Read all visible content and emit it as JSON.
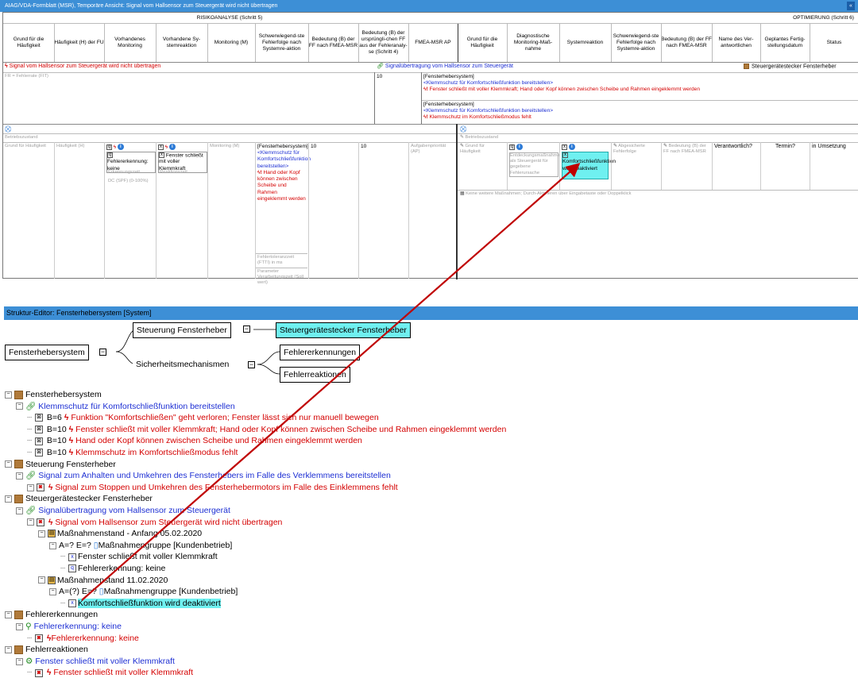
{
  "window": {
    "title": "AIAG/VDA-Formblatt (MSR), Temporäre Ansicht: Signal vom Hallsensor zum Steuergerät wird nicht übertragen",
    "close_glyph": "«"
  },
  "form": {
    "section_risk": "RISIKOANALYSE (Schritt 5)",
    "section_opt": "OPTIMIERUNG (Schritt 6)",
    "headers": [
      "Grund für die Häufigkeit",
      "Häufigkeit (H) der FU",
      "Vorhandenes Monitoring",
      "Vorhandene Sy-stemreaktion",
      "Monitoring (M)",
      "Schwerwiegend-ste Fehlerfolge nach Systemre-aktion",
      "Bedeutung (B) der FF nach FMEA-MSR",
      "Bedeutung (B) der ursprüngli-chen FF aus der Fehleranaly-se (Schritt 4)",
      "FMEA-MSR AP",
      "Grund für die Häufigkeit",
      "Diagnostische Monitoring-Maß-nahme",
      "Systemreaktion",
      "Schwerwiegend-ste Fehlerfolge nach Systemre-aktion",
      "Bedeutung (B) der FF nach FMEA-MSR",
      "Name des Ver-antwortlichen",
      "Geplantes Fertig-stellungsdatum",
      "Status"
    ],
    "row1_failure": "Signal vom Hallsensor zum Steuergerät wird nicht übertragen",
    "row1_function": "Signalübertragung vom Hallsensor zum Steuergerät",
    "row1_element": "Steuergerätestecker Fensterheber",
    "fr_label": "FR = Fehlerrate (FIT)",
    "b_value_top": "10",
    "effect1_sys": "[Fensterhebersystem]",
    "effect1_fn": "<Klemmschutz für Komfortschließfunktion bereitstellen>",
    "effect1_fail": "Fenster schließt mit voller Klemmkraft; Hand oder Kopf können zwischen Scheibe und Rahmen eingeklemmt werden",
    "effect2_sys": "[Fensterhebersystem]",
    "effect2_fn": "<Klemmschutz für Komfortschließfunktion bereitstellen>",
    "effect2_fail": "Klemmschutz im Komfortschließmodus fehlt",
    "betriebszustand": "Betriebszustand",
    "ph_grund": "Grund für Häufigkeit",
    "ph_haeuf": "Häufigkeit (H)",
    "mon_text": "Fehlererkennung: keine",
    "ph_erkzeit": "Erkennungszeit",
    "ph_dc": "DC (SPF) (0-100%)",
    "sysreact_text": "Fenster schließt mit voller Klemmkraft",
    "ph_reakzeit": "Reaktionszeit",
    "ph_mon": "Monitoring (M)",
    "sev_sys": "[Fensterhebersystem]",
    "sev_fn": "<Klemmschutz für Komfortschließfunktion bereitstellen>",
    "sev_fail": "Hand oder Kopf können zwischen Scheibe und Rahmen eingeklemmt werden",
    "ph_ftti": "Fehlertoleranzzeit (FTTI) in ms",
    "ph_param": "Parameter Verarbeitungszeit (Soll wert)",
    "b_after": "10",
    "b_orig": "10",
    "ph_ap": "Aufgabenpriorität (AP)",
    "opt_betrieb": "Betriebszustand",
    "opt_grund": "Grund für Häufigkeit",
    "opt_diag": "Entdeckungsmaßnahme als Steuergerät für gegebene Fehlerursache",
    "opt_react": "Komfortschließfunktion wird deaktiviert",
    "opt_fe": "Abgesicherte Fehlerfolge",
    "opt_b": "Bedeutung (B) der FF nach FMEA-MSR",
    "opt_resp": "Verantwortlich?",
    "opt_date": "Termin?",
    "opt_status": "in Umsetzung",
    "opt_hint": "Keine weitere Maßnahmen; Durch-Aktivieren über Eingabetaste oder Doppelklick"
  },
  "structure": {
    "title": "Struktur-Editor: Fensterhebersystem [System]",
    "root": "Fensterhebersystem",
    "child1": "Steuerung Fensterheber",
    "child1_sel": "Steuergerätestecker Fensterheber",
    "child2": "Sicherheitsmechanismen",
    "child2_a": "Fehlererkennungen",
    "child2_b": "Fehlerreaktionen"
  },
  "tree": [
    {
      "indent": 0,
      "kind": "brown",
      "text": "Fensterhebersystem",
      "color": "#000000"
    },
    {
      "indent": 1,
      "kind": "fn",
      "text": "Klemmschutz für Komfortschließfunktion bereitstellen",
      "color": "#1d2fd3"
    },
    {
      "indent": 2,
      "kind": "effect",
      "prefix": "B=6",
      "text": "Funktion \"Komfortschließen\" geht verloren; Fenster lässt sich nur manuell bewegen",
      "color": "#d40000"
    },
    {
      "indent": 2,
      "kind": "effect",
      "prefix": "B=10",
      "text": "Fenster schließt mit voller Klemmkraft; Hand oder Kopf können zwischen Scheibe und Rahmen eingeklemmt werden",
      "color": "#d40000"
    },
    {
      "indent": 2,
      "kind": "effect",
      "prefix": "B=10",
      "text": "Hand oder Kopf können zwischen Scheibe und Rahmen eingeklemmt werden",
      "color": "#d40000"
    },
    {
      "indent": 2,
      "kind": "effect",
      "prefix": "B=10",
      "text": "Klemmschutz im Komfortschließmodus fehlt",
      "color": "#d40000"
    },
    {
      "indent": 0,
      "kind": "brown",
      "text": "Steuerung Fensterheber",
      "color": "#000000"
    },
    {
      "indent": 1,
      "kind": "fn",
      "text": "Signal zum Anhalten und Umkehren des Fensterhebers im Falle des Verklemmens bereitstellen",
      "color": "#1d2fd3"
    },
    {
      "indent": 2,
      "kind": "fail",
      "text": "Signal zum Stoppen und Umkehren des Fensterhebermotors im Falle des Einklemmens fehlt",
      "color": "#d40000"
    },
    {
      "indent": 0,
      "kind": "brown",
      "text": "Steuergerätestecker Fensterheber",
      "color": "#000000"
    },
    {
      "indent": 1,
      "kind": "fn",
      "text": "Signalübertragung vom Hallsensor zum Steuergerät",
      "color": "#1d2fd3"
    },
    {
      "indent": 2,
      "kind": "fail",
      "text": "Signal vom Hallsensor zum Steuergerät wird nicht übertragen",
      "color": "#d40000"
    },
    {
      "indent": 3,
      "kind": "state",
      "text": "Maßnahmenstand - Anfang 05.02.2020",
      "color": "#000000"
    },
    {
      "indent": 4,
      "kind": "group",
      "prefix": "A=? E=?",
      "text": "Maßnahmengruppe [Kundenbetrieb]",
      "color": "#000000"
    },
    {
      "indent": 5,
      "kind": "measure",
      "text": "Fenster schließt mit voller Klemmkraft",
      "color": "#000000"
    },
    {
      "indent": 5,
      "kind": "detect",
      "text": "Fehlererkennung: keine",
      "color": "#000000"
    },
    {
      "indent": 3,
      "kind": "state",
      "text": "Maßnahmenstand 11.02.2020",
      "color": "#000000"
    },
    {
      "indent": 4,
      "kind": "group",
      "prefix": "A=(?) E=?",
      "text": "Maßnahmengruppe [Kundenbetrieb]",
      "color": "#000000"
    },
    {
      "indent": 5,
      "kind": "measure_sel",
      "text": "Komfortschließfunktion wird deaktiviert",
      "color": "#000000"
    },
    {
      "indent": 0,
      "kind": "brown",
      "text": "Fehlererkennungen",
      "color": "#000000"
    },
    {
      "indent": 1,
      "kind": "fn2",
      "text": "Fehlererkennung: keine",
      "color": "#1d2fd3"
    },
    {
      "indent": 2,
      "kind": "fail2",
      "text": "Fehlererkennung: keine",
      "color": "#d40000"
    },
    {
      "indent": 0,
      "kind": "brown",
      "text": "Fehlerreaktionen",
      "color": "#000000"
    },
    {
      "indent": 1,
      "kind": "fn3",
      "text": "Fenster schließt mit voller Klemmkraft",
      "color": "#1d2fd3"
    },
    {
      "indent": 2,
      "kind": "fail3",
      "text": "Fenster schließt mit voller Klemmkraft",
      "color": "#d40000"
    }
  ],
  "colors": {
    "accent": "#3d8fd6",
    "selection": "#6ff0f0",
    "failure": "#d40000",
    "function": "#1d2fd3",
    "arrow": "#c00000"
  }
}
